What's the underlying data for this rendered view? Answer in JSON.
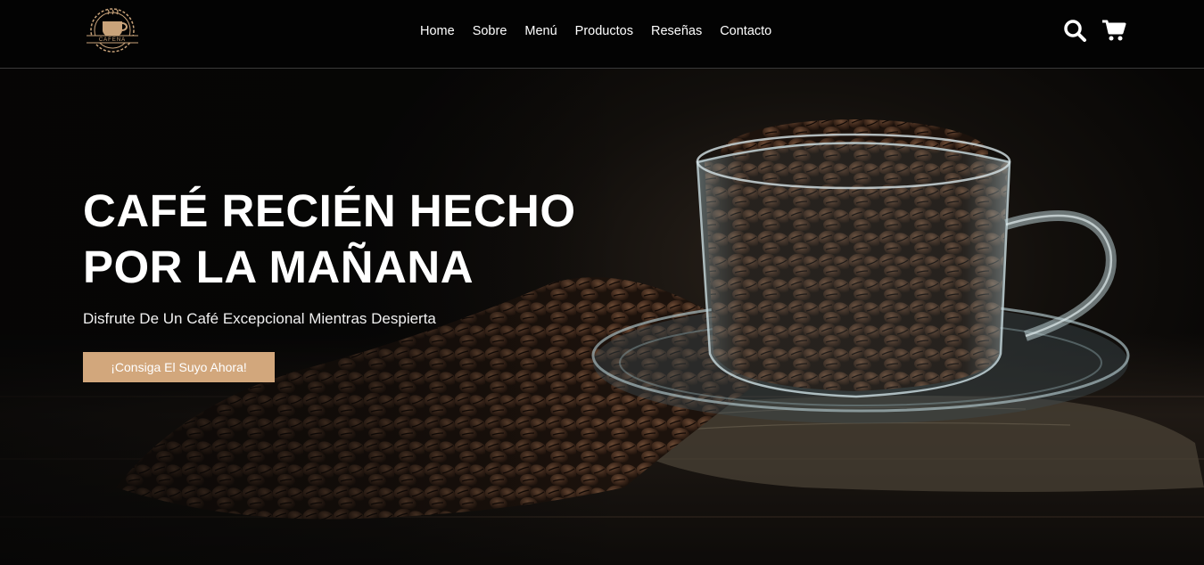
{
  "brand": {
    "logo_text": "CAFENA"
  },
  "nav": {
    "items": [
      {
        "label": "Home"
      },
      {
        "label": "Sobre"
      },
      {
        "label": "Menú"
      },
      {
        "label": "Productos"
      },
      {
        "label": "Reseñas"
      },
      {
        "label": "Contacto"
      }
    ]
  },
  "icons": {
    "search": "search-icon",
    "cart": "cart-icon"
  },
  "hero": {
    "title_line1": "CAFÉ RECIÉN HECHO",
    "title_line2": "POR LA MAÑANA",
    "subtitle": "Disfrute De Un Café Excepcional Mientras Despierta",
    "cta_label": "¡Consiga El Suyo Ahora!"
  },
  "colors": {
    "header_bg": "#030303",
    "accent": "#d2a77c",
    "text": "#ffffff",
    "logo": "#c9a37a"
  }
}
